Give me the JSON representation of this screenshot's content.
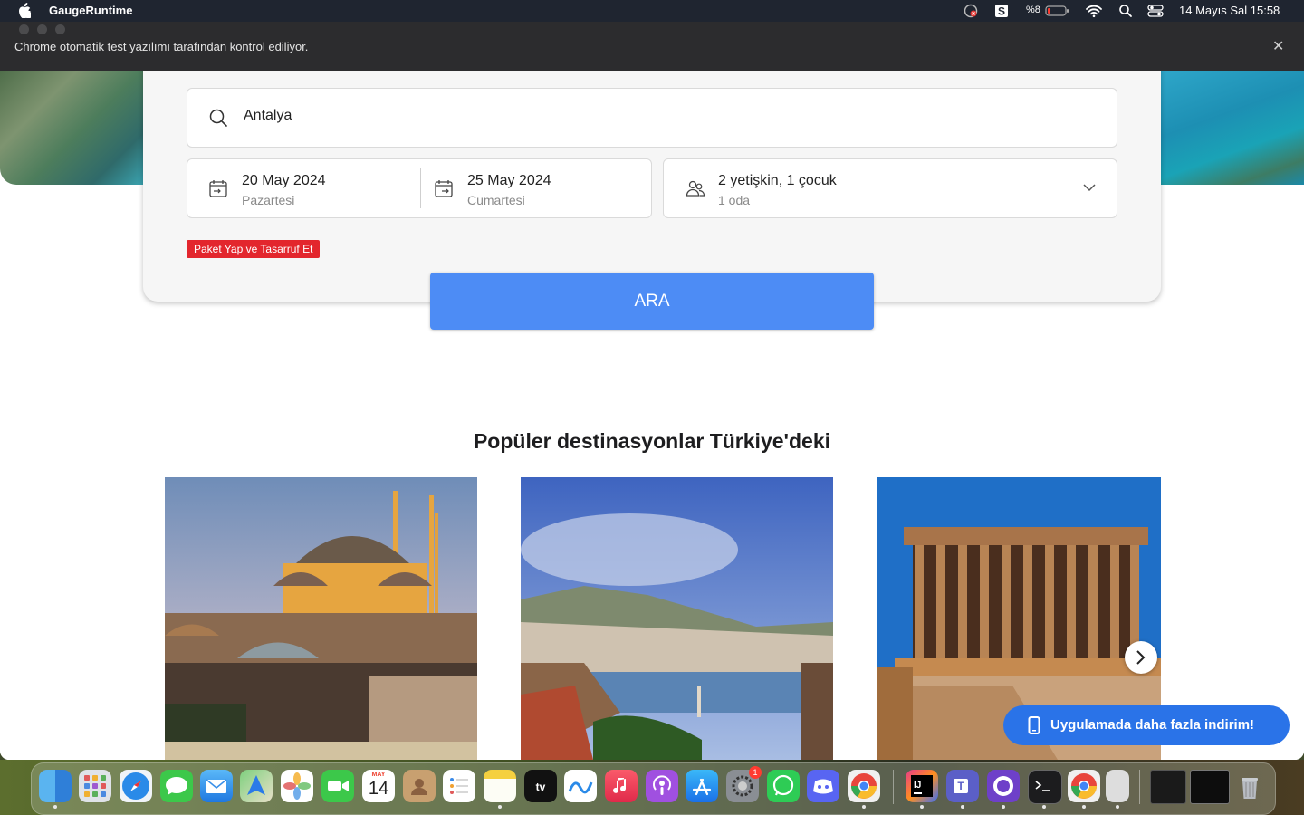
{
  "menubar": {
    "app_name": "GaugeRuntime",
    "battery_percent": "%8",
    "datetime": "14 Mayıs Sal  15:58"
  },
  "browser": {
    "automation_notice": "Chrome otomatik test yazılımı tarafından kontrol ediliyor.",
    "close_symbol": "✕"
  },
  "search": {
    "destination_value": "Antalya",
    "checkin": {
      "date": "20 May 2024",
      "weekday": "Pazartesi"
    },
    "checkout": {
      "date": "25 May 2024",
      "weekday": "Cumartesi"
    },
    "guests": {
      "summary": "2 yetişkin, 1 çocuk",
      "rooms": "1 oda"
    },
    "package_badge": "Paket Yap ve Tasarruf Et",
    "button_label": "ARA"
  },
  "destinations": {
    "title": "Popüler destinasyonlar Türkiye'deki",
    "cards": [
      {
        "scene": "istanbul-mosque-photo"
      },
      {
        "scene": "alanya-coast-photo"
      },
      {
        "scene": "ankara-mausoleum-photo"
      }
    ]
  },
  "app_promo": {
    "label": "Uygulamada daha fazla indirim!"
  },
  "dock": {
    "calendar": {
      "month": "MAY",
      "day": "14"
    },
    "settings_badge": "1",
    "apps": [
      "Finder",
      "Launchpad",
      "Safari",
      "Messages",
      "Mail",
      "Maps",
      "Photos",
      "FaceTime",
      "Calendar",
      "Contacts",
      "Reminders",
      "Notes",
      "TV",
      "Freeform",
      "Music",
      "Podcasts",
      "App Store",
      "System Settings",
      "WhatsApp",
      "Discord",
      "Chrome",
      "IntelliJ IDEA",
      "Microsoft Teams",
      "GitHub Desktop",
      "Terminal",
      "Chrome",
      "Preview",
      "Recent window",
      "Recent window",
      "Trash"
    ]
  },
  "colors": {
    "primary_button": "#4d8cf5",
    "badge_red": "#e3262d",
    "promo_blue": "#2a73e8"
  }
}
